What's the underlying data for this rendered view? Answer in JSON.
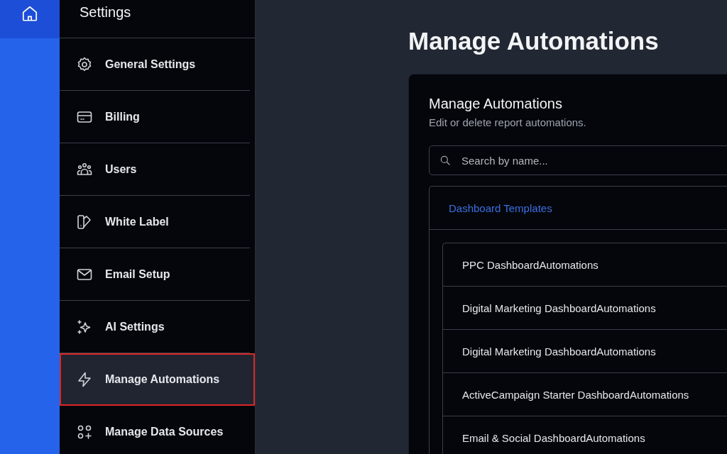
{
  "sidebar": {
    "title": "Settings",
    "items": [
      {
        "label": "General Settings",
        "selected": false
      },
      {
        "label": "Billing",
        "selected": false
      },
      {
        "label": "Users",
        "selected": false
      },
      {
        "label": "White Label",
        "selected": false
      },
      {
        "label": "Email Setup",
        "selected": false
      },
      {
        "label": "AI Settings",
        "selected": false
      },
      {
        "label": "Manage Automations",
        "selected": true
      },
      {
        "label": "Manage Data Sources",
        "selected": false
      }
    ]
  },
  "main": {
    "title": "Manage Automations",
    "card": {
      "title": "Manage Automations",
      "subtitle": "Edit or delete report automations.",
      "search": {
        "placeholder": "Search by name..."
      },
      "group": {
        "title": "Dashboard Templates",
        "items": [
          "PPC DashboardAutomations",
          "Digital Marketing DashboardAutomations",
          "Digital Marketing DashboardAutomations",
          "ActiveCampaign Starter DashboardAutomations",
          "Email & Social DashboardAutomations"
        ]
      }
    }
  }
}
